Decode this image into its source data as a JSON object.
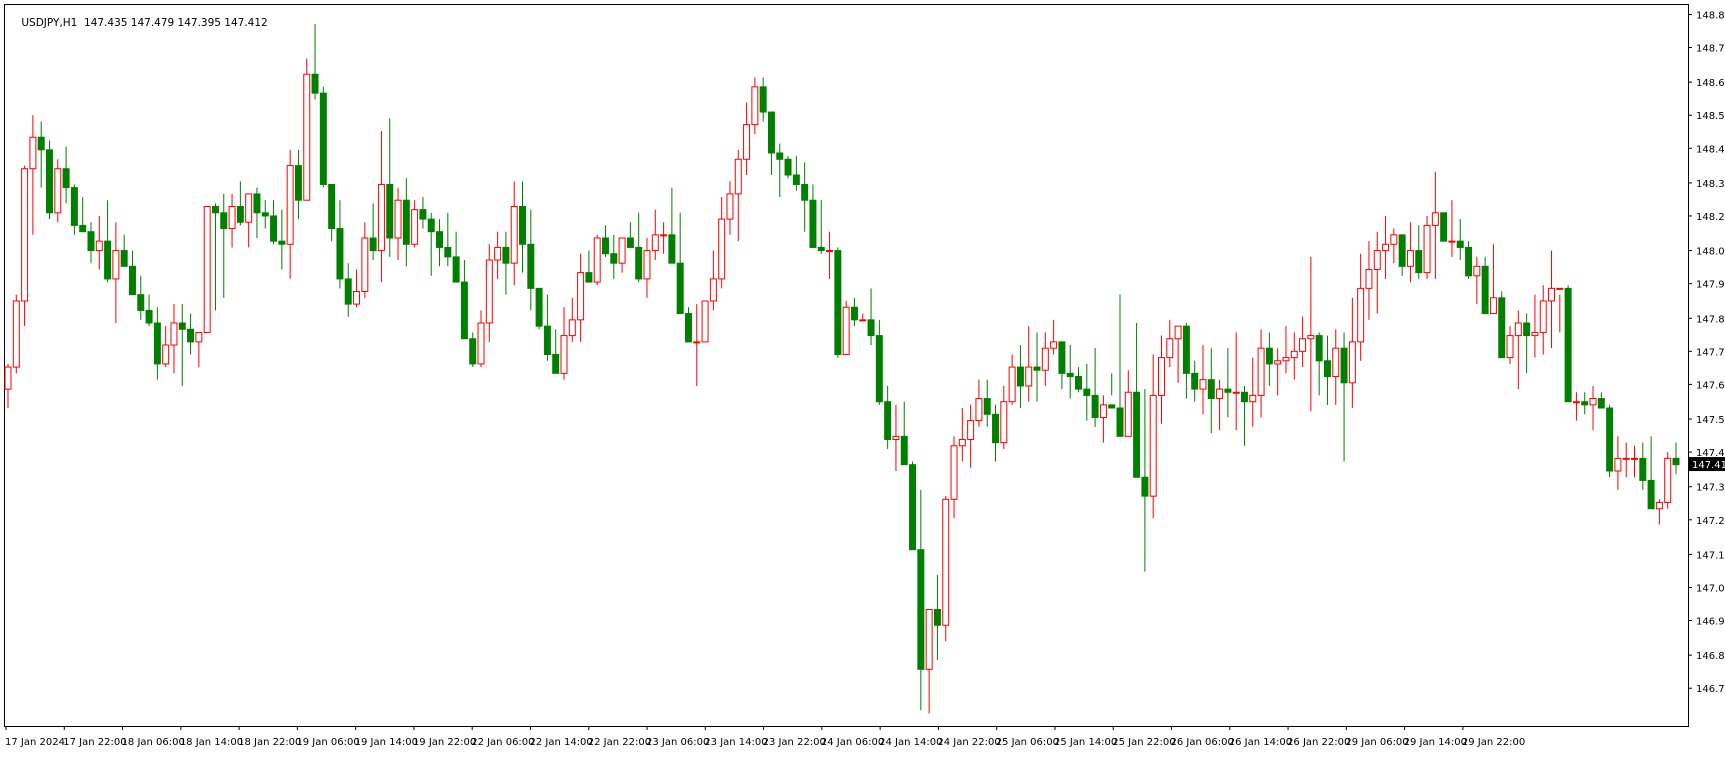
{
  "header": {
    "symbol": "USDJPY,H1",
    "ohlc": "147.435 147.479 147.395 147.412"
  },
  "colors": {
    "background": "#ffffff",
    "frame": "#000000",
    "bull": "#ff0000",
    "bear": "#008000",
    "price_tag_bg": "#000000",
    "price_tag_fg": "#ffffff"
  },
  "chart_data": {
    "type": "candlestick",
    "symbol": "USDJPY",
    "timeframe": "H1",
    "title": "USDJPY,H1  147.435 147.479 147.395 147.412",
    "grid": false,
    "ylim": [
      146.58,
      148.87
    ],
    "y_ticks": [
      "148.840",
      "148.735",
      "148.625",
      "148.520",
      "148.415",
      "148.305",
      "148.200",
      "148.090",
      "147.985",
      "147.875",
      "147.770",
      "147.665",
      "147.555",
      "147.450",
      "147.340",
      "147.235",
      "147.125",
      "147.020",
      "146.915",
      "146.805",
      "146.700"
    ],
    "x_ticks": [
      "17 Jan 2024",
      "17 Jan 22:00",
      "18 Jan 06:00",
      "18 Jan 14:00",
      "18 Jan 22:00",
      "19 Jan 06:00",
      "19 Jan 14:00",
      "19 Jan 22:00",
      "22 Jan 06:00",
      "22 Jan 14:00",
      "22 Jan 22:00",
      "23 Jan 06:00",
      "23 Jan 14:00",
      "23 Jan 22:00",
      "24 Jan 06:00",
      "24 Jan 14:00",
      "24 Jan 22:00",
      "25 Jan 06:00",
      "25 Jan 14:00",
      "25 Jan 22:00",
      "26 Jan 06:00",
      "26 Jan 14:00",
      "26 Jan 22:00",
      "29 Jan 06:00",
      "29 Jan 14:00",
      "29 Jan 22:00"
    ],
    "last_price": "147.412",
    "candles": [
      [
        147.65,
        147.73,
        147.59,
        147.72
      ],
      [
        147.72,
        147.95,
        147.7,
        147.93
      ],
      [
        147.93,
        148.36,
        147.85,
        148.35
      ],
      [
        148.35,
        148.52,
        148.14,
        148.45
      ],
      [
        148.45,
        148.5,
        148.29,
        148.41
      ],
      [
        148.41,
        148.44,
        148.19,
        148.21
      ],
      [
        148.21,
        148.38,
        148.18,
        148.35
      ],
      [
        148.35,
        148.42,
        148.24,
        148.29
      ],
      [
        148.29,
        148.3,
        148.14,
        148.17
      ],
      [
        148.17,
        148.26,
        148.15,
        148.15
      ],
      [
        148.15,
        148.18,
        148.05,
        148.09
      ],
      [
        148.09,
        148.2,
        148.03,
        148.12
      ],
      [
        148.12,
        148.25,
        147.99,
        148.0
      ],
      [
        148.0,
        148.18,
        147.86,
        148.09
      ],
      [
        148.09,
        148.14,
        148.04,
        148.04
      ],
      [
        148.04,
        148.09,
        147.96,
        147.95
      ],
      [
        147.95,
        148.01,
        147.87,
        147.9
      ],
      [
        147.9,
        147.95,
        147.85,
        147.86
      ],
      [
        147.86,
        147.91,
        147.68,
        147.73
      ],
      [
        147.73,
        147.85,
        147.72,
        147.79
      ],
      [
        147.79,
        147.92,
        147.7,
        147.86
      ],
      [
        147.86,
        147.92,
        147.66,
        147.84
      ],
      [
        147.84,
        147.89,
        147.76,
        147.8
      ],
      [
        147.8,
        147.83,
        147.72,
        147.83
      ],
      [
        147.83,
        147.94,
        147.83,
        148.23
      ],
      [
        148.23,
        148.24,
        147.9,
        148.21
      ],
      [
        148.21,
        148.27,
        147.94,
        148.16
      ],
      [
        148.16,
        148.27,
        148.1,
        148.23
      ],
      [
        148.23,
        148.31,
        148.17,
        148.18
      ],
      [
        148.18,
        148.27,
        148.1,
        148.27
      ],
      [
        148.27,
        148.29,
        148.13,
        148.21
      ],
      [
        148.21,
        148.25,
        148.16,
        148.2
      ],
      [
        148.2,
        148.25,
        148.11,
        148.12
      ],
      [
        148.12,
        148.22,
        148.03,
        148.11
      ],
      [
        148.11,
        148.41,
        148.0,
        148.36
      ],
      [
        148.36,
        148.41,
        148.19,
        148.25
      ],
      [
        148.25,
        148.7,
        148.25,
        148.65
      ],
      [
        148.65,
        148.81,
        148.57,
        148.59
      ],
      [
        148.59,
        148.61,
        148.29,
        148.3
      ],
      [
        148.3,
        148.16,
        148.12,
        148.16
      ],
      [
        148.16,
        148.25,
        147.97,
        148.0
      ],
      [
        148.0,
        148.05,
        147.88,
        147.92
      ],
      [
        147.92,
        148.03,
        147.91,
        147.96
      ],
      [
        147.96,
        148.18,
        147.94,
        148.13
      ],
      [
        148.13,
        148.24,
        148.06,
        148.09
      ],
      [
        148.09,
        148.47,
        147.99,
        148.3
      ],
      [
        148.3,
        148.51,
        148.07,
        148.13
      ],
      [
        148.13,
        148.29,
        148.06,
        148.25
      ],
      [
        148.25,
        148.32,
        148.04,
        148.11
      ],
      [
        148.11,
        148.25,
        148.1,
        148.22
      ],
      [
        148.22,
        148.26,
        148.16,
        148.19
      ],
      [
        148.19,
        148.21,
        148.01,
        148.15
      ],
      [
        148.15,
        148.19,
        148.04,
        148.1
      ],
      [
        148.1,
        148.21,
        148.04,
        148.07
      ],
      [
        148.07,
        148.15,
        147.99,
        147.99
      ],
      [
        147.99,
        148.06,
        147.81,
        147.81
      ],
      [
        147.81,
        147.83,
        147.72,
        147.73
      ],
      [
        147.73,
        147.9,
        147.72,
        147.86
      ],
      [
        147.86,
        148.11,
        147.8,
        148.06
      ],
      [
        148.06,
        148.15,
        148.0,
        148.1
      ],
      [
        148.1,
        148.15,
        147.95,
        148.05
      ],
      [
        148.05,
        148.31,
        147.98,
        148.23
      ],
      [
        148.23,
        148.31,
        148.02,
        148.11
      ],
      [
        148.11,
        148.22,
        147.9,
        147.97
      ],
      [
        147.97,
        147.97,
        147.84,
        147.85
      ],
      [
        147.85,
        147.95,
        147.74,
        147.76
      ],
      [
        147.76,
        147.84,
        147.71,
        147.7
      ],
      [
        147.7,
        147.91,
        147.68,
        147.82
      ],
      [
        147.82,
        147.94,
        147.8,
        147.87
      ],
      [
        147.87,
        148.08,
        147.8,
        148.02
      ],
      [
        148.02,
        148.09,
        147.99,
        147.99
      ],
      [
        147.99,
        148.14,
        147.98,
        148.13
      ],
      [
        148.13,
        148.17,
        148.07,
        148.08
      ],
      [
        148.08,
        148.14,
        148.0,
        148.05
      ],
      [
        148.05,
        148.13,
        148.02,
        148.13
      ],
      [
        148.13,
        148.18,
        148.1,
        148.1
      ],
      [
        148.1,
        148.21,
        147.99,
        148.0
      ],
      [
        148.0,
        148.13,
        147.94,
        148.09
      ],
      [
        148.09,
        148.22,
        148.06,
        148.14
      ],
      [
        148.14,
        148.18,
        148.08,
        148.14
      ],
      [
        148.14,
        148.29,
        148.05,
        148.05
      ],
      [
        148.05,
        148.21,
        147.89,
        147.89
      ],
      [
        147.89,
        147.91,
        147.81,
        147.8
      ],
      [
        147.8,
        147.92,
        147.66,
        147.8
      ],
      [
        147.8,
        147.93,
        147.84,
        147.93
      ],
      [
        147.93,
        148.09,
        147.9,
        148.0
      ],
      [
        148.0,
        148.26,
        147.97,
        148.19
      ],
      [
        148.19,
        148.31,
        148.14,
        148.27
      ],
      [
        148.27,
        148.41,
        148.12,
        148.38
      ],
      [
        148.38,
        148.56,
        148.33,
        148.49
      ],
      [
        148.49,
        148.64,
        148.46,
        148.61
      ],
      [
        148.61,
        148.64,
        148.5,
        148.53
      ],
      [
        148.53,
        148.52,
        148.33,
        148.4
      ],
      [
        148.4,
        148.43,
        148.26,
        148.38
      ],
      [
        148.38,
        148.39,
        148.32,
        148.33
      ],
      [
        148.33,
        148.39,
        148.28,
        148.3
      ],
      [
        148.3,
        148.37,
        148.15,
        148.25
      ],
      [
        148.25,
        148.3,
        148.1,
        148.1
      ],
      [
        148.1,
        148.25,
        148.08,
        148.09
      ],
      [
        148.09,
        148.15,
        148.0,
        148.09
      ],
      [
        148.09,
        148.1,
        147.75,
        147.76
      ],
      [
        147.76,
        147.93,
        147.76,
        147.91
      ],
      [
        147.91,
        147.94,
        147.85,
        147.87
      ],
      [
        147.87,
        147.89,
        147.87,
        147.87
      ],
      [
        147.87,
        147.97,
        147.79,
        147.82
      ],
      [
        147.82,
        147.87,
        147.6,
        147.61
      ],
      [
        147.61,
        147.66,
        147.46,
        147.49
      ],
      [
        147.49,
        147.6,
        147.39,
        147.5
      ],
      [
        147.5,
        147.61,
        147.42,
        147.41
      ],
      [
        147.41,
        147.42,
        147.14,
        147.14
      ],
      [
        147.14,
        147.33,
        146.63,
        146.76
      ],
      [
        146.76,
        146.95,
        146.62,
        146.95
      ],
      [
        146.95,
        147.06,
        146.79,
        146.9
      ],
      [
        146.9,
        147.31,
        146.85,
        147.3
      ],
      [
        147.3,
        147.5,
        147.24,
        147.47
      ],
      [
        147.47,
        147.59,
        147.42,
        147.49
      ],
      [
        147.49,
        147.6,
        147.4,
        147.55
      ],
      [
        147.55,
        147.68,
        147.53,
        147.62
      ],
      [
        147.62,
        147.68,
        147.53,
        147.57
      ],
      [
        147.57,
        147.6,
        147.42,
        147.48
      ],
      [
        147.48,
        147.66,
        147.46,
        147.61
      ],
      [
        147.61,
        147.76,
        147.6,
        147.72
      ],
      [
        147.72,
        147.79,
        147.59,
        147.66
      ],
      [
        147.66,
        147.85,
        147.61,
        147.72
      ],
      [
        147.72,
        147.83,
        147.61,
        147.71
      ],
      [
        147.71,
        147.83,
        147.66,
        147.78
      ],
      [
        147.78,
        147.87,
        147.76,
        147.8
      ],
      [
        147.8,
        147.79,
        147.65,
        147.7
      ],
      [
        147.7,
        147.79,
        147.62,
        147.69
      ],
      [
        147.69,
        147.72,
        147.64,
        147.65
      ],
      [
        147.65,
        147.73,
        147.55,
        147.63
      ],
      [
        147.63,
        147.78,
        147.53,
        147.56
      ],
      [
        147.56,
        147.63,
        147.48,
        147.6
      ],
      [
        147.6,
        147.7,
        147.63,
        147.59
      ],
      [
        147.59,
        147.95,
        147.54,
        147.5
      ],
      [
        147.5,
        147.71,
        147.54,
        147.64
      ],
      [
        147.64,
        147.86,
        147.46,
        147.37
      ],
      [
        147.37,
        147.65,
        147.07,
        147.31
      ],
      [
        147.31,
        147.76,
        147.24,
        147.63
      ],
      [
        147.63,
        147.82,
        147.54,
        147.75
      ],
      [
        147.75,
        147.87,
        147.72,
        147.81
      ],
      [
        147.81,
        147.85,
        147.67,
        147.85
      ],
      [
        147.85,
        147.86,
        147.62,
        147.7
      ],
      [
        147.7,
        147.74,
        147.61,
        147.65
      ],
      [
        147.65,
        147.79,
        147.57,
        147.68
      ],
      [
        147.68,
        147.78,
        147.51,
        147.62
      ],
      [
        147.62,
        147.68,
        147.52,
        147.65
      ],
      [
        147.65,
        147.78,
        147.56,
        147.64
      ],
      [
        147.64,
        147.83,
        147.52,
        147.64
      ],
      [
        147.64,
        147.66,
        147.47,
        147.61
      ],
      [
        147.61,
        147.75,
        147.53,
        147.63
      ],
      [
        147.63,
        147.84,
        147.56,
        147.78
      ],
      [
        147.78,
        147.83,
        147.66,
        147.73
      ],
      [
        147.73,
        147.78,
        147.63,
        147.74
      ],
      [
        147.74,
        147.85,
        147.7,
        147.75
      ],
      [
        147.75,
        147.83,
        147.68,
        147.77
      ],
      [
        147.77,
        147.88,
        147.72,
        147.81
      ],
      [
        147.81,
        148.07,
        147.58,
        147.82
      ],
      [
        147.82,
        147.83,
        147.63,
        147.74
      ],
      [
        147.74,
        147.82,
        147.6,
        147.69
      ],
      [
        147.69,
        147.84,
        147.6,
        147.78
      ],
      [
        147.78,
        147.83,
        147.42,
        147.67
      ],
      [
        147.67,
        147.94,
        147.59,
        147.8
      ],
      [
        147.8,
        148.08,
        147.74,
        147.97
      ],
      [
        147.97,
        148.12,
        147.87,
        148.03
      ],
      [
        148.03,
        148.15,
        147.89,
        148.09
      ],
      [
        148.09,
        148.2,
        148.0,
        148.11
      ],
      [
        148.11,
        148.16,
        148.05,
        148.14
      ],
      [
        148.14,
        148.13,
        148.01,
        148.04
      ],
      [
        148.04,
        148.18,
        147.99,
        148.09
      ],
      [
        148.09,
        148.17,
        148.0,
        148.02
      ],
      [
        148.02,
        148.2,
        148.0,
        148.17
      ],
      [
        148.17,
        148.34,
        148.0,
        148.21
      ],
      [
        148.21,
        148.21,
        148.13,
        148.12
      ],
      [
        148.12,
        148.25,
        148.07,
        148.12
      ],
      [
        148.12,
        148.19,
        148.06,
        148.1
      ],
      [
        148.1,
        148.12,
        148.0,
        148.01
      ],
      [
        148.01,
        148.07,
        147.92,
        148.04
      ],
      [
        148.04,
        148.07,
        147.89,
        147.89
      ],
      [
        147.89,
        148.11,
        147.89,
        147.94
      ],
      [
        147.94,
        147.96,
        147.75,
        147.75
      ],
      [
        147.75,
        147.85,
        147.73,
        147.82
      ],
      [
        147.82,
        147.9,
        147.65,
        147.86
      ],
      [
        147.86,
        147.89,
        147.7,
        147.82
      ],
      [
        147.82,
        147.95,
        147.75,
        147.83
      ],
      [
        147.83,
        147.98,
        147.76,
        147.93
      ],
      [
        147.93,
        148.09,
        147.78,
        147.97
      ],
      [
        147.97,
        147.95,
        147.83,
        147.97
      ],
      [
        147.97,
        147.98,
        147.62,
        147.61
      ],
      [
        147.61,
        147.64,
        147.55,
        147.61
      ],
      [
        147.61,
        147.64,
        147.57,
        147.6
      ],
      [
        147.6,
        147.66,
        147.52,
        147.62
      ],
      [
        147.62,
        147.64,
        147.6,
        147.59
      ],
      [
        147.59,
        147.6,
        147.37,
        147.39
      ],
      [
        147.39,
        147.5,
        147.33,
        147.43
      ],
      [
        147.43,
        147.48,
        147.37,
        147.43
      ],
      [
        147.43,
        147.47,
        147.37,
        147.43
      ],
      [
        147.43,
        147.48,
        147.33,
        147.36
      ],
      [
        147.36,
        147.5,
        147.27,
        147.27
      ],
      [
        147.27,
        147.3,
        147.22,
        147.29
      ],
      [
        147.29,
        147.45,
        147.27,
        147.43
      ],
      [
        147.43,
        147.48,
        147.38,
        147.41
      ]
    ]
  }
}
